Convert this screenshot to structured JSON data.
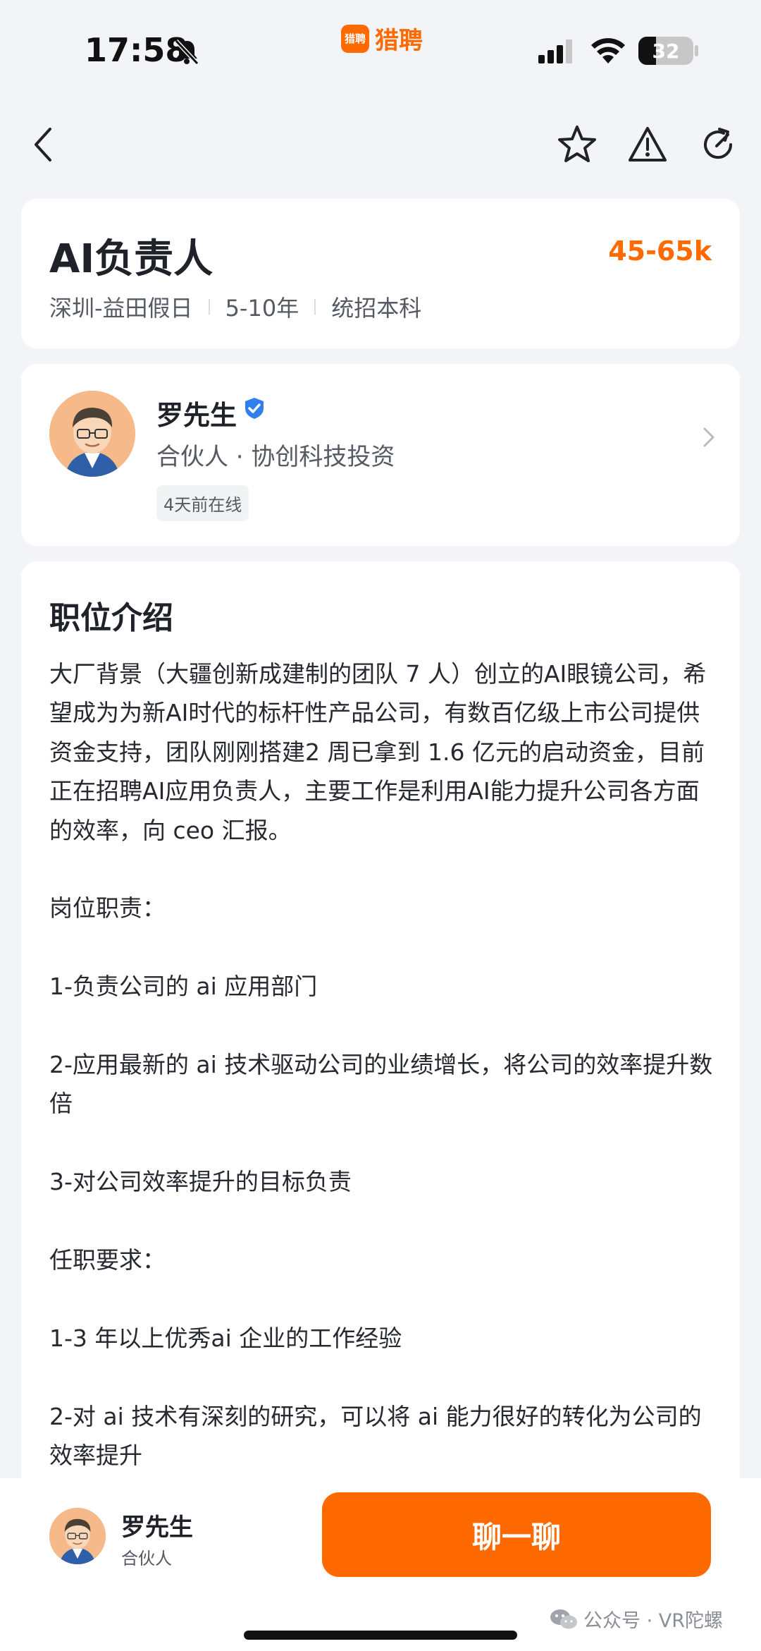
{
  "status": {
    "time": "17:58",
    "app_brand": "猎聘",
    "app_logo_text": "猎聘",
    "battery": "32",
    "battery_level": 0.32
  },
  "nav": {
    "icons": [
      "back-icon",
      "star-icon",
      "report-icon",
      "share-icon"
    ]
  },
  "job": {
    "title": "AI负责人",
    "salary": "45-65k",
    "location": "深圳-益田假日",
    "experience": "5-10年",
    "education": "统招本科"
  },
  "recruiter": {
    "name": "罗先生",
    "title_company": "合伙人 · 协创科技投资",
    "online_status": "4天前在线"
  },
  "description": {
    "heading": "职位介绍",
    "paragraphs": [
      "大厂背景（大疆创新成建制的团队 7 人）创立的AI眼镜公司，希望成为为新AI时代的标杆性产品公司，有数百亿级上市公司提供资金支持，团队刚刚搭建2 周已拿到 1.6 亿元的启动资金，目前正在招聘AI应用负责人，主要工作是利用AI能力提升公司各方面的效率，向 ceo 汇报。",
      "岗位职责：",
      "1-负责公司的 ai 应用部门",
      "2-应用最新的 ai 技术驱动公司的业绩增长，将公司的效率提升数倍",
      "3-对公司效率提升的目标负责",
      "任职要求：",
      "1-3 年以上优秀ai 企业的工作经验",
      "2-对 ai 技术有深刻的研究，可以将 ai 能力很好的转化为公司的效率提升"
    ]
  },
  "bottom": {
    "name": "罗先生",
    "role": "合伙人",
    "chat_label": "聊一聊"
  },
  "watermark": "公众号 · VR陀螺",
  "colors": {
    "accent": "#ff6a00",
    "background": "#f3f4f7",
    "verified": "#2f80ed"
  }
}
